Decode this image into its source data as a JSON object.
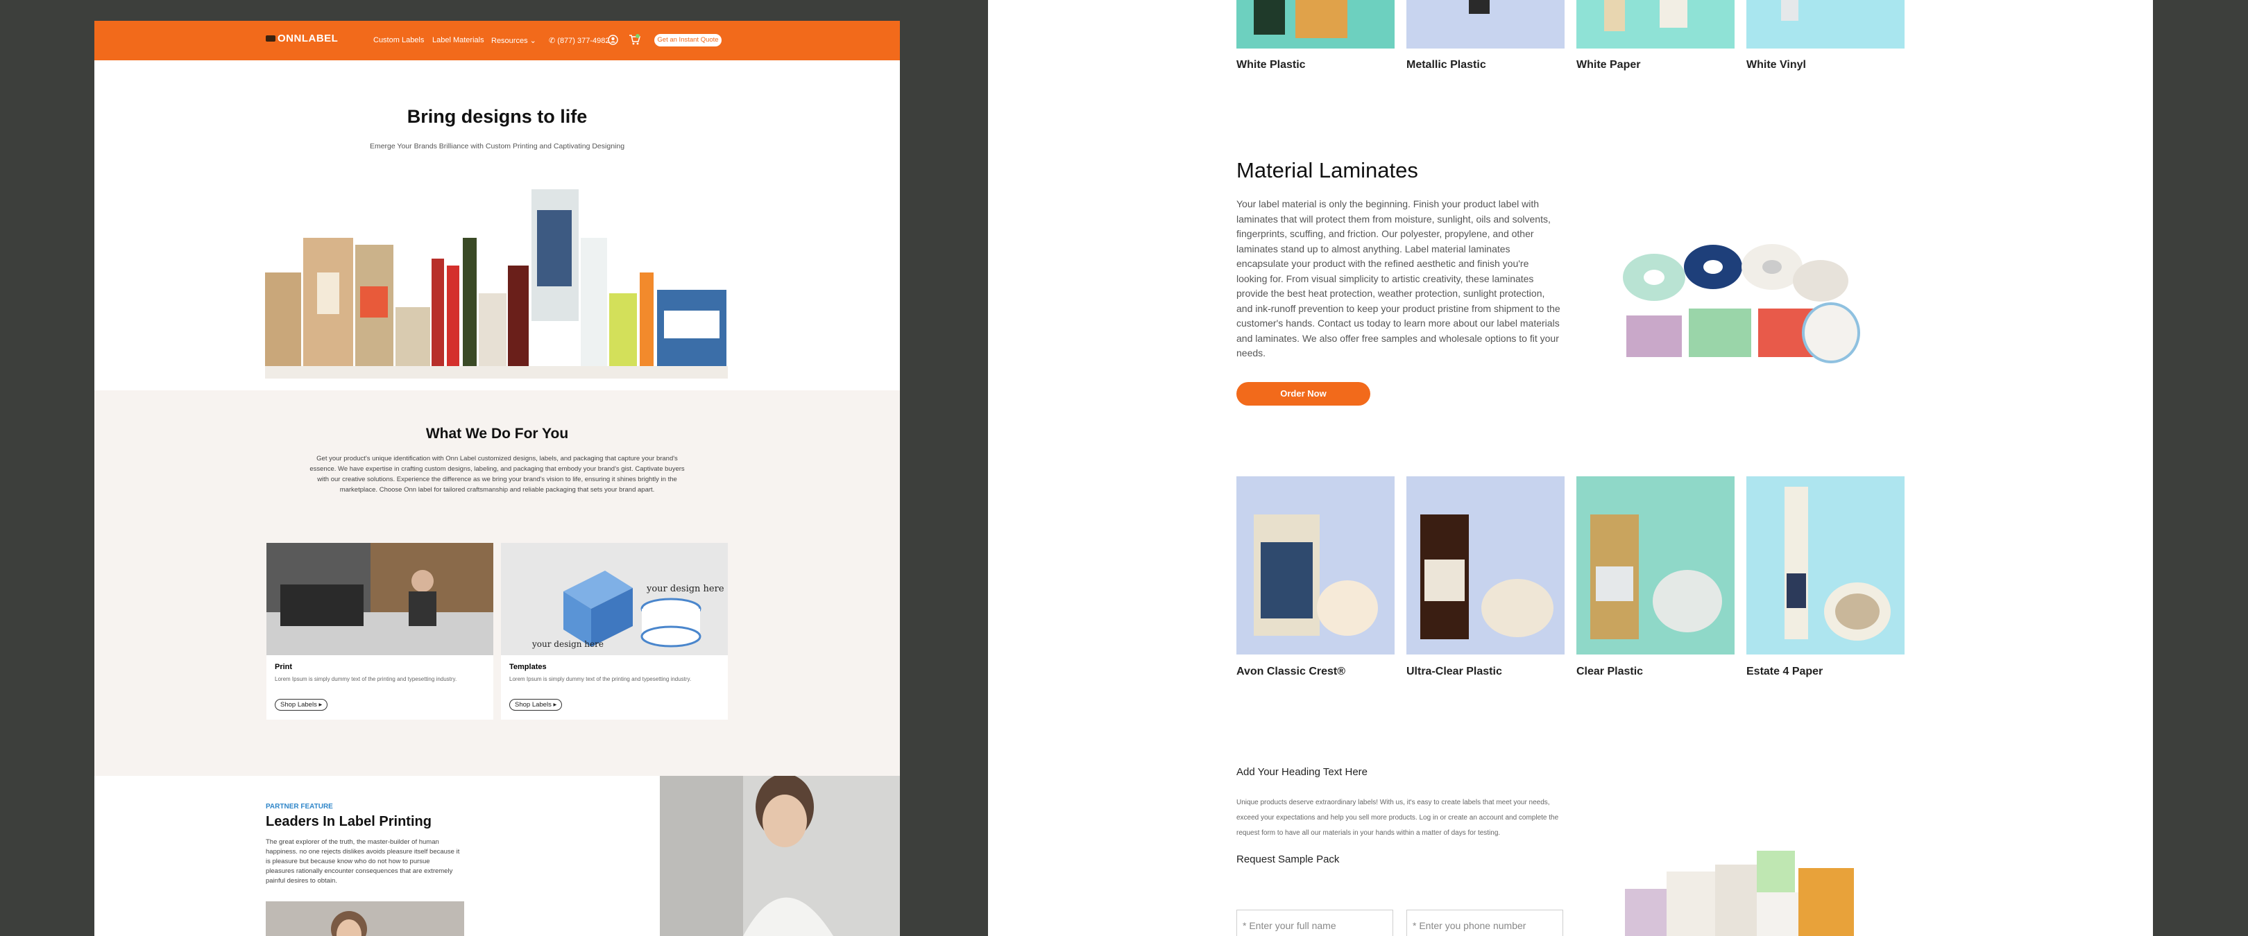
{
  "nav": {
    "logo": "ONNLABEL",
    "custom_labels": "Custom Labels",
    "label_materials": "Label Materials",
    "resources": "Resources",
    "phone": "(877) 377-4982",
    "cta": "Get an Instant Quote"
  },
  "hero": {
    "title": "Bring designs to life",
    "subtitle": "Emerge Your Brands Brilliance with Custom Printing and Captivating Designing"
  },
  "services": {
    "title": "What We Do For You",
    "body": "Get your product's unique identification with Onn Label customized designs, labels, and packaging that capture your brand's essence. We have expertise in crafting custom designs, labeling, and packaging that embody your brand's gist. Captivate buyers with our creative solutions. Experience the difference as we bring your brand's vision to life, ensuring it shines brightly in the marketplace. Choose Onn label for tailored craftsmanship and reliable packaging that sets your brand apart.",
    "cards": [
      {
        "title": "Print",
        "text": "Lorem Ipsum is simply dummy text of the printing and typesetting industry.",
        "button": "Shop Labels"
      },
      {
        "title": "Templates",
        "text": "Lorem Ipsum is simply dummy text of the printing and typesetting industry.",
        "button": "Shop Labels"
      }
    ]
  },
  "partner": {
    "eyebrow": "PARTNER FEATURE",
    "title": "Leaders In Label Printing",
    "body": "The great explorer of the truth, the master-builder of human happiness. no one rejects dislikes avoids pleasure itself because it is pleasure but because know who do not how to pursue pleasures rationally encounter consequences that are extremely painful desires to obtain."
  },
  "materials_top": [
    "White Plastic",
    "Metallic Plastic",
    "White Paper",
    "White Vinyl"
  ],
  "laminates": {
    "title": "Material Laminates",
    "body": "Your label material is only the beginning. Finish your product label with laminates that will protect them from moisture, sunlight, oils and solvents, fingerprints, scuffing, and friction. Our polyester, propylene, and other laminates stand up to almost anything. Label material laminates encapsulate your product with the refined aesthetic and finish you're looking for. From visual simplicity to artistic creativity, these laminates provide the best heat protection, weather protection, sunlight protection, and ink-runoff prevention to keep your product pristine from shipment to the customer's hands. Contact us today to learn more about our label materials and laminates. We also offer free samples and wholesale options to fit your needs.",
    "button": "Order Now"
  },
  "materials_bottom": [
    "Avon Classic Crest®",
    "Ultra-Clear Plastic",
    "Clear Plastic",
    "Estate 4 Paper"
  ],
  "sample": {
    "heading": "Add Your Heading Text Here",
    "body": "Unique products deserve extraordinary labels! With us, it's easy to create labels that meet your needs, exceed your expectations and help you sell more products. Log in or create an account and complete the request form to have all our materials in your hands within a matter of days for testing.",
    "subheading": "Request Sample Pack",
    "name_placeholder": "* Enter your full name",
    "phone_placeholder": "* Enter you phone number"
  },
  "colors": {
    "brand": "#f26a1b",
    "background": "#3d3f3c",
    "section_bg": "#f7f3f0"
  },
  "icons": [
    "phone-icon",
    "user-icon",
    "cart-icon",
    "chevron-down-icon"
  ]
}
